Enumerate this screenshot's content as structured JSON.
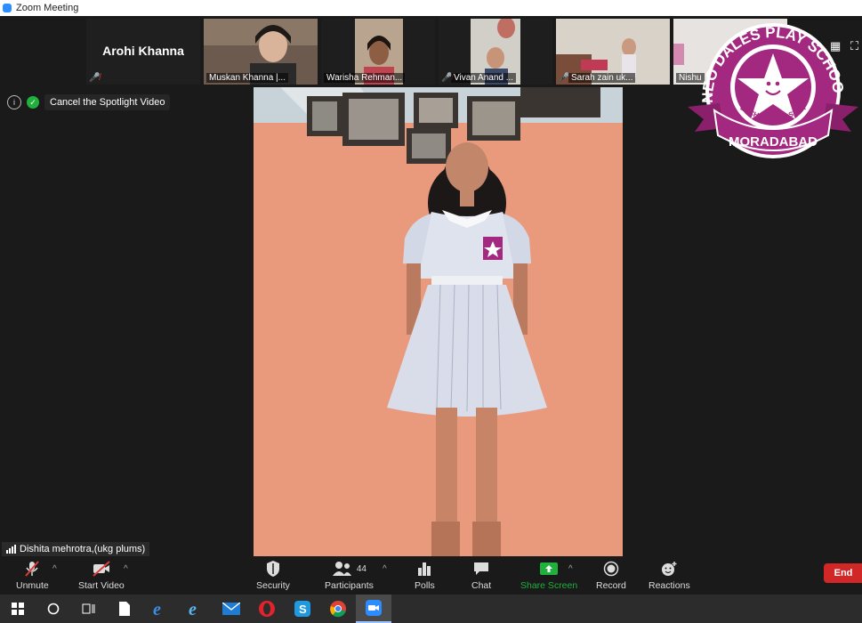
{
  "window": {
    "title": "Zoom Meeting"
  },
  "gallery": {
    "tiles": [
      {
        "name": "Arohi Khanna",
        "label": "",
        "muted": true,
        "name_only": true
      },
      {
        "name": "",
        "label": "Muskan Khanna |...",
        "muted": false
      },
      {
        "name": "",
        "label": "Warisha Rehman...",
        "muted": false
      },
      {
        "name": "",
        "label": "Vivan Anand ...",
        "muted": true
      },
      {
        "name": "",
        "label": "Sarah zain uk...",
        "muted": true
      },
      {
        "name": "",
        "label": "Nishu",
        "muted": false
      }
    ]
  },
  "spotlight": {
    "cancel_label": "Cancel the Spotlight Video"
  },
  "speaker": {
    "name": "Dishita mehrotra,(ukg plums)"
  },
  "logo": {
    "line1": "NEO DALES PLAY SCHOOL",
    "tagline": "EACH CHILD A STAR",
    "city": "MORADABAD"
  },
  "toolbar": {
    "unmute": "Unmute",
    "start_video": "Start Video",
    "security": "Security",
    "participants": "Participants",
    "participants_count": "44",
    "polls": "Polls",
    "chat": "Chat",
    "share_screen": "Share Screen",
    "record": "Record",
    "reactions": "Reactions",
    "end": "End"
  },
  "colors": {
    "share_green": "#1fb13c",
    "end_red": "#d12727",
    "logo_purple": "#a3287f",
    "zoom_blue": "#2D8CFF"
  },
  "taskbar": {
    "icons": [
      "windows-start-icon",
      "search-circle-icon",
      "task-view-icon",
      "file-icon",
      "edge-legacy-icon",
      "edge-icon",
      "mail-icon",
      "opera-icon",
      "skype-icon",
      "chrome-icon",
      "zoom-icon"
    ]
  }
}
